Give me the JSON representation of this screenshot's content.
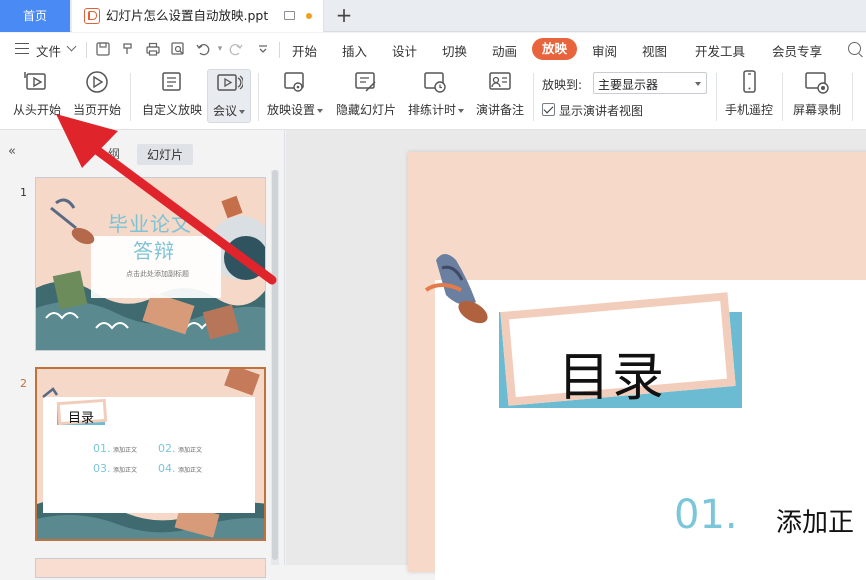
{
  "tabs": {
    "home": "首页",
    "document": "幻灯片怎么设置自动放映.ppt"
  },
  "menu": {
    "file": "文件",
    "items": [
      "开始",
      "插入",
      "设计",
      "切换",
      "动画",
      "放映",
      "审阅",
      "视图",
      "开发工具",
      "会员专享"
    ],
    "active": "放映"
  },
  "ribbon": {
    "from_start": "从头开始",
    "from_current": "当页开始",
    "custom_show": "自定义放映",
    "meeting": "会议",
    "show_settings": "放映设置",
    "hide_slide": "隐藏幻灯片",
    "rehearse_timing": "排练计时",
    "speaker_notes": "演讲备注",
    "play_to_label": "放映到:",
    "play_to_value": "主要显示器",
    "presenter_view_label": "显示演讲者视图",
    "presenter_view_checked": true,
    "phone_remote": "手机遥控",
    "screen_record": "屏幕录制"
  },
  "left_panel": {
    "outline_tab": "纲",
    "slides_tab": "幻灯片",
    "thumb1": {
      "number": "1",
      "title_line1": "毕业论文",
      "title_line2": "答辩",
      "subtitle": "点击此处添加副标题"
    },
    "thumb2": {
      "number": "2",
      "title": "目录",
      "items": [
        {
          "num": "01.",
          "text": "添加正文"
        },
        {
          "num": "02.",
          "text": "添加正文"
        },
        {
          "num": "03.",
          "text": "添加正文"
        },
        {
          "num": "04.",
          "text": "添加正文"
        }
      ]
    }
  },
  "slide": {
    "title": "目录",
    "item_num": "01.",
    "item_text": "添加正"
  },
  "colors": {
    "accent": "#e8643c",
    "home_tab": "#4a8af4",
    "arrow": "#e0242b",
    "teal": "#6bbcd3",
    "peach": "#f7d9c9"
  }
}
